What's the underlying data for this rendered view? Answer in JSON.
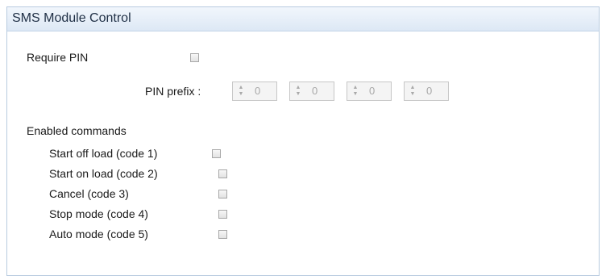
{
  "panel": {
    "title": "SMS Module Control"
  },
  "require_pin": {
    "label": "Require PIN",
    "checked": false
  },
  "pin_prefix": {
    "label": "PIN prefix :",
    "digits": [
      "0",
      "0",
      "0",
      "0"
    ],
    "enabled": false
  },
  "enabled_commands": {
    "heading": "Enabled commands",
    "items": [
      {
        "label": "Start off load (code 1)",
        "checked": false
      },
      {
        "label": "Start on load (code 2)",
        "checked": false
      },
      {
        "label": "Cancel (code 3)",
        "checked": false
      },
      {
        "label": "Stop mode (code 4)",
        "checked": false
      },
      {
        "label": "Auto mode (code 5)",
        "checked": false
      }
    ]
  },
  "icons": {
    "spinner": "up-down-arrows-icon",
    "checkbox": "checkbox-unchecked"
  }
}
